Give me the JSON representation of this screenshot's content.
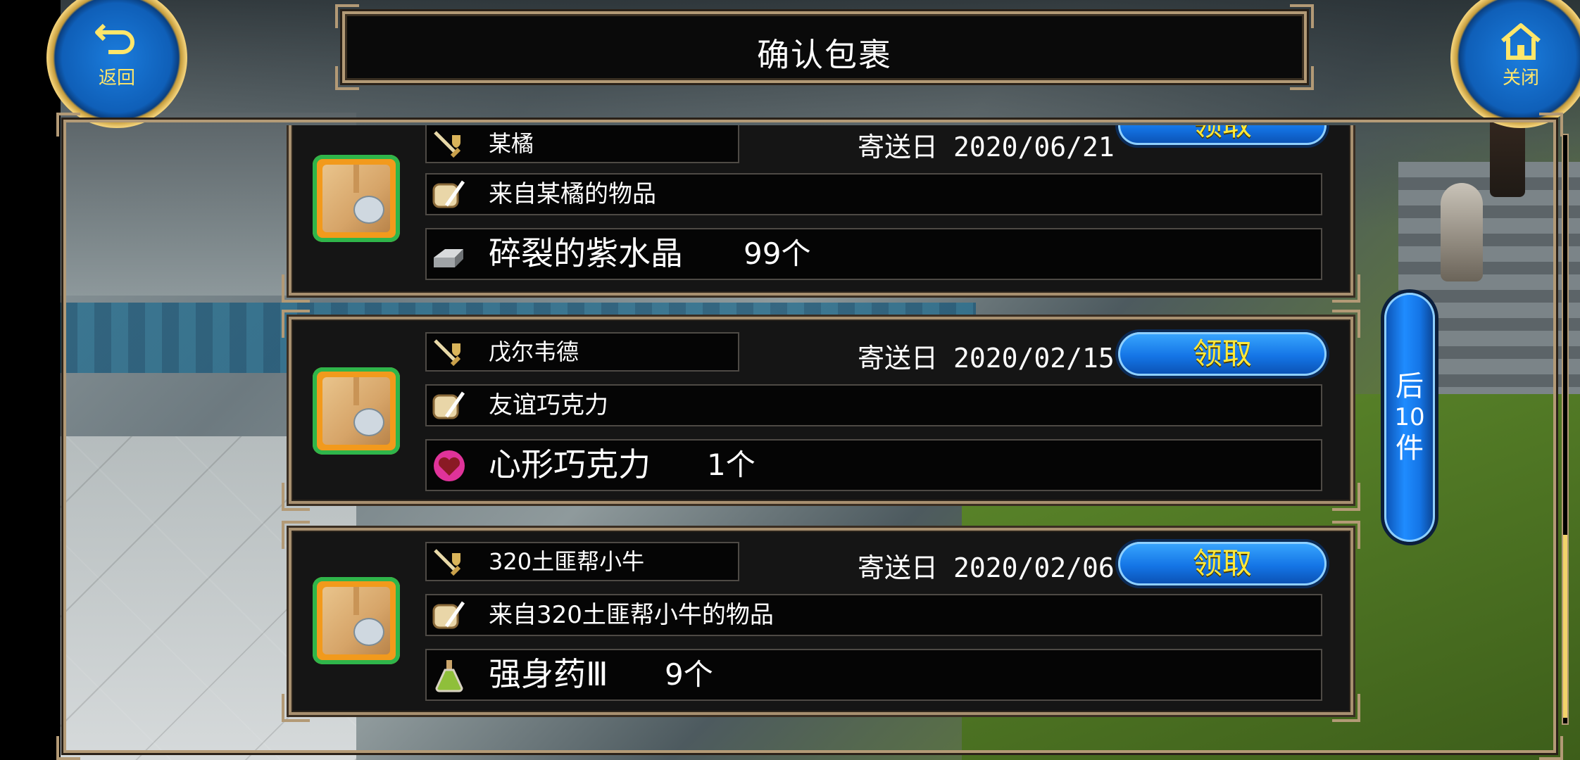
{
  "header": {
    "title": "确认包裹"
  },
  "buttons": {
    "back_label": "返回",
    "close_label": "关闭"
  },
  "next_page": {
    "line1": "后",
    "line2": "10",
    "line3": "件"
  },
  "sent_label": "寄送日",
  "claim_label": "领取",
  "mails": [
    {
      "sender": "某橘",
      "date": "2020/06/21",
      "message": "来自某橘的物品",
      "item_name": "碎裂的紫水晶",
      "item_qty": "99个",
      "item_icon": "silver-ingot-icon"
    },
    {
      "sender": "戊尔韦德",
      "date": "2020/02/15",
      "message": "友谊巧克力",
      "item_name": "心形巧克力",
      "item_qty": "1个",
      "item_icon": "heart-chocolate-icon"
    },
    {
      "sender": "320土匪帮小牛",
      "date": "2020/02/06",
      "message": "来自320土匪帮小牛的物品",
      "item_name": "强身药Ⅲ",
      "item_qty": "9个",
      "item_icon": "potion-flask-icon"
    }
  ],
  "colors": {
    "frame_gold": "#b39a76",
    "claim_blue": "#1475e6",
    "claim_text": "#ffe93a",
    "box_border_green": "#2fb54a"
  }
}
